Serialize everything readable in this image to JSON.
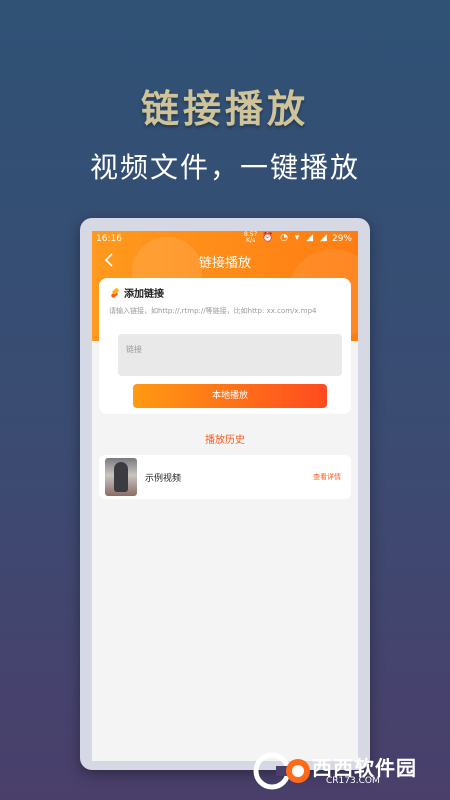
{
  "hero": {
    "title": "链接播放",
    "subtitle": "视频文件，一键播放"
  },
  "statusbar": {
    "time": "16:16",
    "speed_value": "8.57",
    "speed_unit": "K/s",
    "icons": "⏰ ◔ ▾ ◢ ◢",
    "battery": "29%"
  },
  "nav": {
    "back_icon": "chevron-left-icon",
    "title": "链接播放"
  },
  "add_link": {
    "title": "添加链接",
    "hint": "请输入链接，如http://,rtmp://等链接，比如http: xx.com/x.mp4",
    "input_placeholder": "链接",
    "play_label": "本地播放"
  },
  "history": {
    "title": "播放历史",
    "items": [
      {
        "label": "示例视频",
        "detail": "查看详情"
      }
    ]
  },
  "watermark": {
    "text": "西西软件园",
    "url": "CR173.COM"
  },
  "colors": {
    "accent": "#ff7d12",
    "accent_red": "#ff5a1f",
    "hero_title": "#cfc39a"
  }
}
